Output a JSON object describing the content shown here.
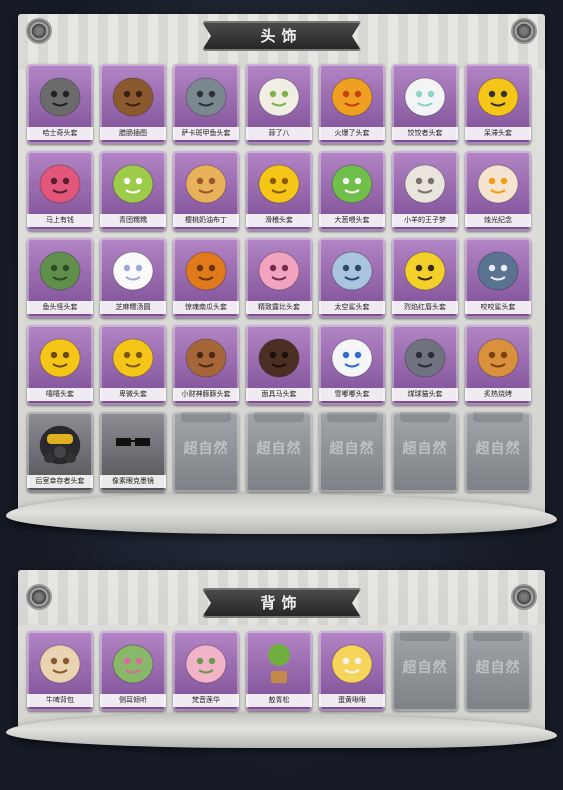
{
  "sections": {
    "head": {
      "title": "头饰",
      "items": [
        {
          "label": "哈士奇头套",
          "icon": "husky-mask-icon",
          "art": "husky"
        },
        {
          "label": "腊肠插图",
          "icon": "dachshund-mask-icon",
          "art": "dachshund"
        },
        {
          "label": "萨卡斑甲鱼头套",
          "icon": "fish-mask-icon",
          "art": "fish"
        },
        {
          "label": "蒜了八",
          "icon": "garlic-mask-icon",
          "art": "garlic"
        },
        {
          "label": "火爆了头套",
          "icon": "fire-mask-icon",
          "art": "fire"
        },
        {
          "label": "饺饺者头套",
          "icon": "dumpling-mask-icon",
          "art": "cloud"
        },
        {
          "label": "呆滞头套",
          "icon": "dazed-face-mask-icon",
          "art": "dazed"
        },
        {
          "label": "马上有钱",
          "icon": "horse-money-mask-icon",
          "art": "pinkhorse"
        },
        {
          "label": "青团糯糯",
          "icon": "green-rice-ball-mask-icon",
          "art": "greenball"
        },
        {
          "label": "樱桃奶油布丁",
          "icon": "pudding-mask-icon",
          "art": "pudding"
        },
        {
          "label": "滑稽头套",
          "icon": "funny-face-mask-icon",
          "art": "funny"
        },
        {
          "label": "大葱喂头套",
          "icon": "scallion-mask-icon",
          "art": "scallion"
        },
        {
          "label": "小羊的王子梦",
          "icon": "sheep-prince-mask-icon",
          "art": "sheep"
        },
        {
          "label": "烛光纪念",
          "icon": "candle-mask-icon",
          "art": "candle"
        },
        {
          "label": "鱼头怪头套",
          "icon": "fish-monster-mask-icon",
          "art": "fishmonster"
        },
        {
          "label": "芝麻糯汤圆",
          "icon": "tangyuan-mask-icon",
          "art": "tangyuan"
        },
        {
          "label": "惊魂南瓜头套",
          "icon": "pumpkin-mask-icon",
          "art": "pumpkin"
        },
        {
          "label": "精致露比头套",
          "icon": "ruby-mask-icon",
          "art": "ruby"
        },
        {
          "label": "太空鲨头套",
          "icon": "space-shark-mask-icon",
          "art": "spaceshark"
        },
        {
          "label": "烈焰红唇头套",
          "icon": "pikachu-mask-icon",
          "art": "pika"
        },
        {
          "label": "咬咬鲨头套",
          "icon": "biting-shark-mask-icon",
          "art": "shark"
        },
        {
          "label": "嘻嘻头套",
          "icon": "grin-mask-icon",
          "art": "grin"
        },
        {
          "label": "卑微头套",
          "icon": "humble-face-mask-icon",
          "art": "humble"
        },
        {
          "label": "小财神豚豚头套",
          "icon": "capybara-mask-icon",
          "art": "capybara"
        },
        {
          "label": "面具马头套",
          "icon": "horse-head-mask-icon",
          "art": "horsehead"
        },
        {
          "label": "雪嘟嘟头套",
          "icon": "snowman-mask-icon",
          "art": "snowman"
        },
        {
          "label": "煤球猫头套",
          "icon": "coal-cat-mask-icon",
          "art": "coalcat"
        },
        {
          "label": "炙热烧烤",
          "icon": "barbecue-mask-icon",
          "art": "bbq"
        },
        {
          "label": "后室幸存者头套",
          "icon": "gas-mask-helmet-icon",
          "art": "gasmask",
          "dark": true
        },
        {
          "label": "像素眼克墨镜",
          "icon": "pixel-sunglasses-icon",
          "art": "sunglasses",
          "dark": true
        },
        {
          "empty": true,
          "logo": "超自然"
        },
        {
          "empty": true,
          "logo": "超自然"
        },
        {
          "empty": true,
          "logo": "超自然"
        },
        {
          "empty": true,
          "logo": "超自然"
        },
        {
          "empty": true,
          "logo": "超自然"
        }
      ]
    },
    "back": {
      "title": "背饰",
      "items": [
        {
          "label": "牛啤背包",
          "icon": "beer-backpack-icon",
          "art": "beer"
        },
        {
          "label": "侧耳倾听",
          "icon": "listening-ear-icon",
          "art": "wreath"
        },
        {
          "label": "梵音莲华",
          "icon": "lotus-icon",
          "art": "lotus"
        },
        {
          "label": "敖青松",
          "icon": "pine-bonsai-icon",
          "art": "bonsai"
        },
        {
          "label": "蛋黄啾啾",
          "icon": "chick-egg-icon",
          "art": "chick"
        },
        {
          "empty": true,
          "logo": "超自然"
        },
        {
          "empty": true,
          "logo": "超自然"
        }
      ]
    }
  }
}
